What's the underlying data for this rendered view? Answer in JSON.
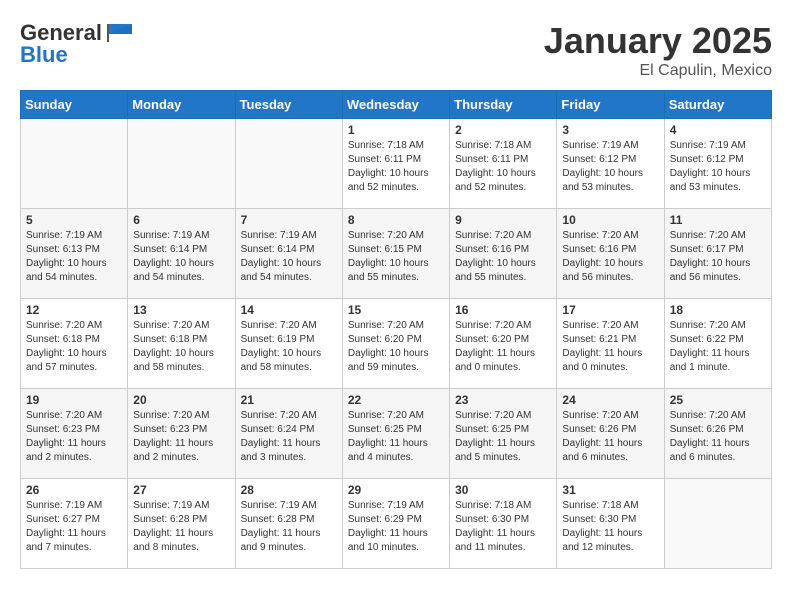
{
  "header": {
    "logo_general": "General",
    "logo_blue": "Blue",
    "title": "January 2025",
    "subtitle": "El Capulin, Mexico"
  },
  "days_of_week": [
    "Sunday",
    "Monday",
    "Tuesday",
    "Wednesday",
    "Thursday",
    "Friday",
    "Saturday"
  ],
  "weeks": [
    [
      {
        "day": "",
        "info": ""
      },
      {
        "day": "",
        "info": ""
      },
      {
        "day": "",
        "info": ""
      },
      {
        "day": "1",
        "info": "Sunrise: 7:18 AM\nSunset: 6:11 PM\nDaylight: 10 hours\nand 52 minutes."
      },
      {
        "day": "2",
        "info": "Sunrise: 7:18 AM\nSunset: 6:11 PM\nDaylight: 10 hours\nand 52 minutes."
      },
      {
        "day": "3",
        "info": "Sunrise: 7:19 AM\nSunset: 6:12 PM\nDaylight: 10 hours\nand 53 minutes."
      },
      {
        "day": "4",
        "info": "Sunrise: 7:19 AM\nSunset: 6:12 PM\nDaylight: 10 hours\nand 53 minutes."
      }
    ],
    [
      {
        "day": "5",
        "info": "Sunrise: 7:19 AM\nSunset: 6:13 PM\nDaylight: 10 hours\nand 54 minutes."
      },
      {
        "day": "6",
        "info": "Sunrise: 7:19 AM\nSunset: 6:14 PM\nDaylight: 10 hours\nand 54 minutes."
      },
      {
        "day": "7",
        "info": "Sunrise: 7:19 AM\nSunset: 6:14 PM\nDaylight: 10 hours\nand 54 minutes."
      },
      {
        "day": "8",
        "info": "Sunrise: 7:20 AM\nSunset: 6:15 PM\nDaylight: 10 hours\nand 55 minutes."
      },
      {
        "day": "9",
        "info": "Sunrise: 7:20 AM\nSunset: 6:16 PM\nDaylight: 10 hours\nand 55 minutes."
      },
      {
        "day": "10",
        "info": "Sunrise: 7:20 AM\nSunset: 6:16 PM\nDaylight: 10 hours\nand 56 minutes."
      },
      {
        "day": "11",
        "info": "Sunrise: 7:20 AM\nSunset: 6:17 PM\nDaylight: 10 hours\nand 56 minutes."
      }
    ],
    [
      {
        "day": "12",
        "info": "Sunrise: 7:20 AM\nSunset: 6:18 PM\nDaylight: 10 hours\nand 57 minutes."
      },
      {
        "day": "13",
        "info": "Sunrise: 7:20 AM\nSunset: 6:18 PM\nDaylight: 10 hours\nand 58 minutes."
      },
      {
        "day": "14",
        "info": "Sunrise: 7:20 AM\nSunset: 6:19 PM\nDaylight: 10 hours\nand 58 minutes."
      },
      {
        "day": "15",
        "info": "Sunrise: 7:20 AM\nSunset: 6:20 PM\nDaylight: 10 hours\nand 59 minutes."
      },
      {
        "day": "16",
        "info": "Sunrise: 7:20 AM\nSunset: 6:20 PM\nDaylight: 11 hours\nand 0 minutes."
      },
      {
        "day": "17",
        "info": "Sunrise: 7:20 AM\nSunset: 6:21 PM\nDaylight: 11 hours\nand 0 minutes."
      },
      {
        "day": "18",
        "info": "Sunrise: 7:20 AM\nSunset: 6:22 PM\nDaylight: 11 hours\nand 1 minute."
      }
    ],
    [
      {
        "day": "19",
        "info": "Sunrise: 7:20 AM\nSunset: 6:23 PM\nDaylight: 11 hours\nand 2 minutes."
      },
      {
        "day": "20",
        "info": "Sunrise: 7:20 AM\nSunset: 6:23 PM\nDaylight: 11 hours\nand 2 minutes."
      },
      {
        "day": "21",
        "info": "Sunrise: 7:20 AM\nSunset: 6:24 PM\nDaylight: 11 hours\nand 3 minutes."
      },
      {
        "day": "22",
        "info": "Sunrise: 7:20 AM\nSunset: 6:25 PM\nDaylight: 11 hours\nand 4 minutes."
      },
      {
        "day": "23",
        "info": "Sunrise: 7:20 AM\nSunset: 6:25 PM\nDaylight: 11 hours\nand 5 minutes."
      },
      {
        "day": "24",
        "info": "Sunrise: 7:20 AM\nSunset: 6:26 PM\nDaylight: 11 hours\nand 6 minutes."
      },
      {
        "day": "25",
        "info": "Sunrise: 7:20 AM\nSunset: 6:26 PM\nDaylight: 11 hours\nand 6 minutes."
      }
    ],
    [
      {
        "day": "26",
        "info": "Sunrise: 7:19 AM\nSunset: 6:27 PM\nDaylight: 11 hours\nand 7 minutes."
      },
      {
        "day": "27",
        "info": "Sunrise: 7:19 AM\nSunset: 6:28 PM\nDaylight: 11 hours\nand 8 minutes."
      },
      {
        "day": "28",
        "info": "Sunrise: 7:19 AM\nSunset: 6:28 PM\nDaylight: 11 hours\nand 9 minutes."
      },
      {
        "day": "29",
        "info": "Sunrise: 7:19 AM\nSunset: 6:29 PM\nDaylight: 11 hours\nand 10 minutes."
      },
      {
        "day": "30",
        "info": "Sunrise: 7:18 AM\nSunset: 6:30 PM\nDaylight: 11 hours\nand 11 minutes."
      },
      {
        "day": "31",
        "info": "Sunrise: 7:18 AM\nSunset: 6:30 PM\nDaylight: 11 hours\nand 12 minutes."
      },
      {
        "day": "",
        "info": ""
      }
    ]
  ]
}
